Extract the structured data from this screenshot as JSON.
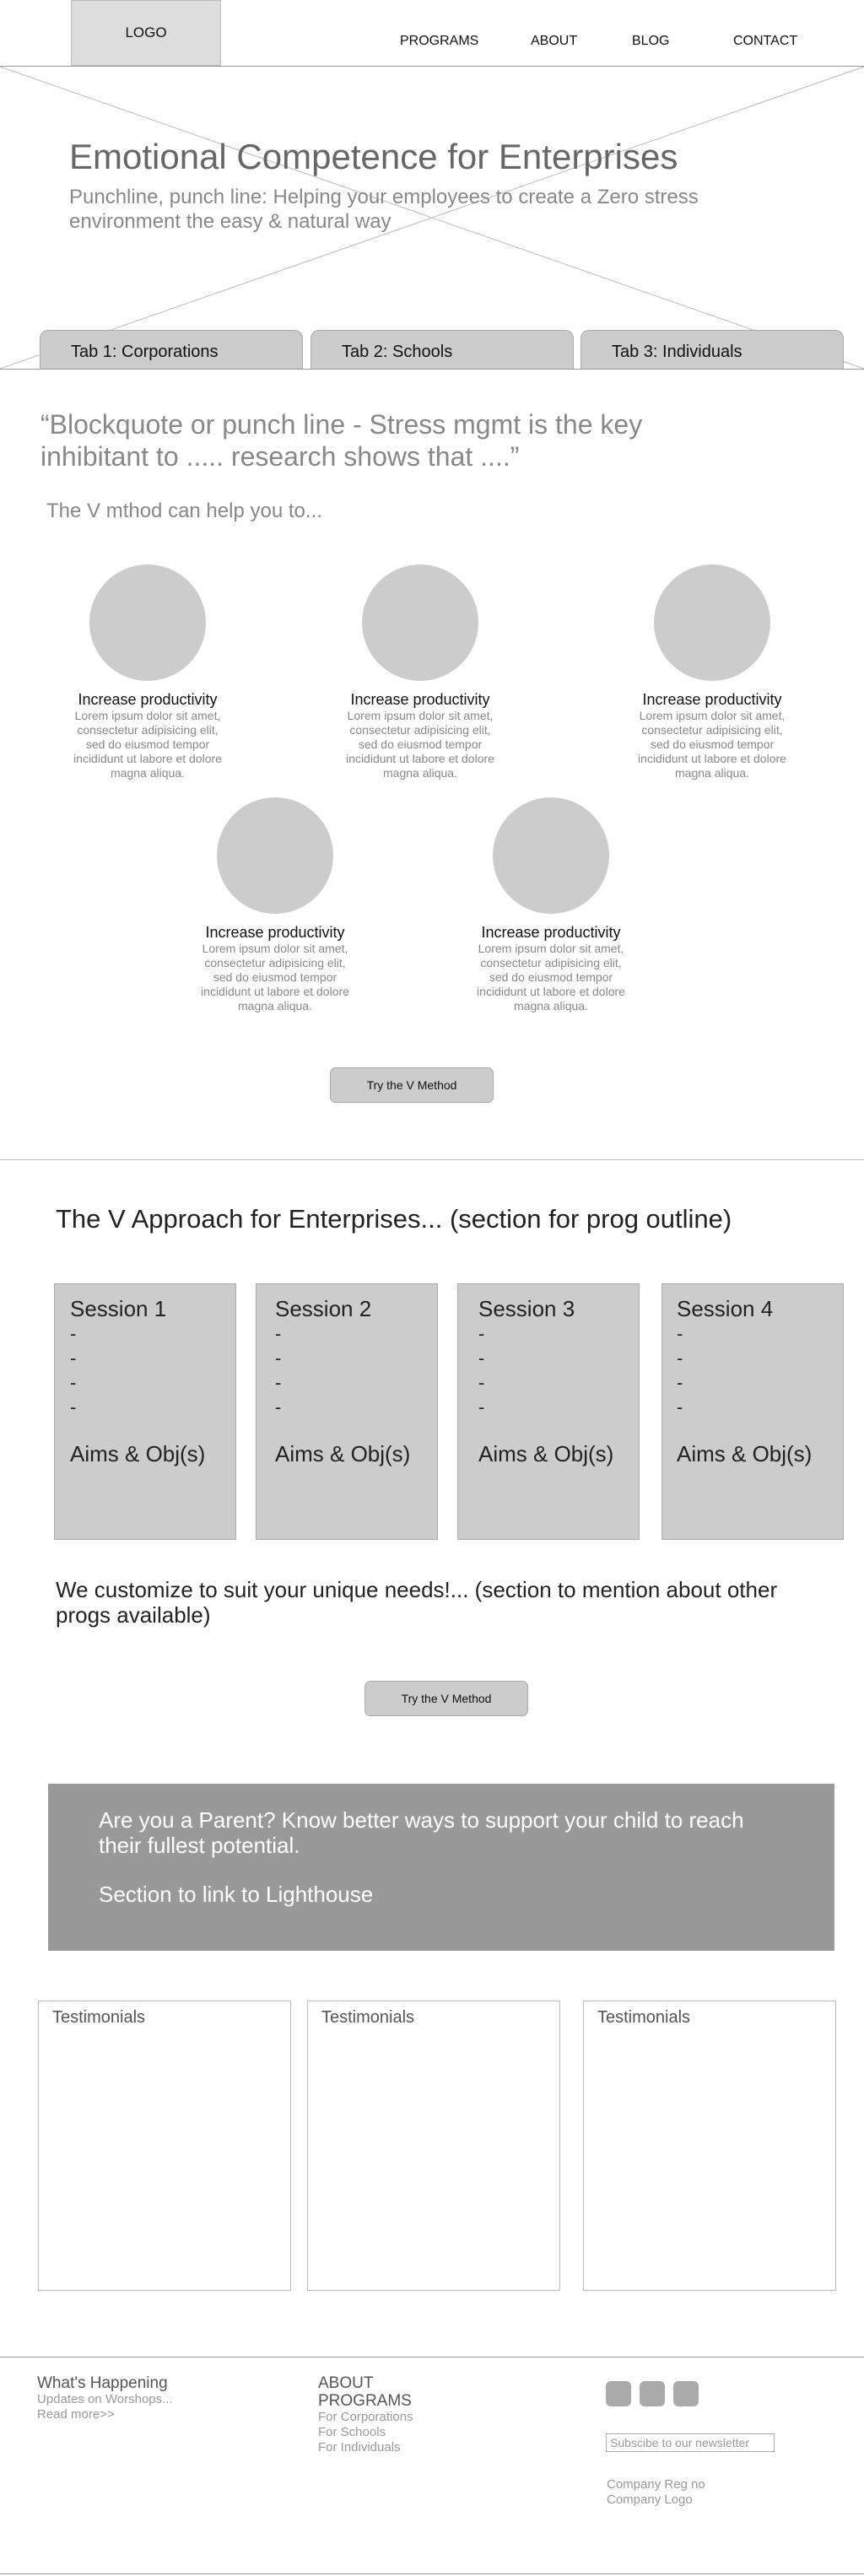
{
  "header": {
    "logo": "LOGO",
    "nav": [
      "PROGRAMS",
      "ABOUT",
      "BLOG",
      "CONTACT"
    ]
  },
  "hero": {
    "title": "Emotional Competence for Enterprises",
    "subtitle": "Punchline, punch line: Helping your employees to create a Zero stress environment the easy & natural way",
    "tabs": [
      "Tab 1: Corporations",
      "Tab 2: Schools",
      "Tab 3: Individuals"
    ]
  },
  "quote": "“Blockquote or punch line - Stress mgmt is the key inhibitant to ..... research shows that ....”",
  "v_method": {
    "lead": "The V mthod can help you to...",
    "benefits": [
      {
        "title": "Increase productivity",
        "text": "Lorem ipsum dolor sit amet, consectetur adipisicing elit, sed do eiusmod tempor incididunt ut labore et dolore magna aliqua."
      },
      {
        "title": "Increase productivity",
        "text": "Lorem ipsum dolor sit amet, consectetur adipisicing elit, sed do eiusmod tempor incididunt ut labore et dolore magna aliqua."
      },
      {
        "title": "Increase productivity",
        "text": "Lorem ipsum dolor sit amet, consectetur adipisicing elit, sed do eiusmod tempor incididunt ut labore et dolore magna aliqua."
      },
      {
        "title": "Increase productivity",
        "text": "Lorem ipsum dolor sit amet, consectetur adipisicing elit, sed do eiusmod tempor incididunt ut labore et dolore magna aliqua."
      },
      {
        "title": "Increase productivity",
        "text": "Lorem ipsum dolor sit amet, consectetur adipisicing elit, sed do eiusmod tempor incididunt ut labore et dolore magna aliqua."
      }
    ],
    "cta": "Try the V Method"
  },
  "approach": {
    "title": "The V Approach for Enterprises... (section for prog outline)",
    "sessions": [
      {
        "title": "Session 1",
        "dashes": [
          "-",
          "-",
          "-",
          "-"
        ],
        "aims": "Aims & Obj(s)"
      },
      {
        "title": "Session 2",
        "dashes": [
          "-",
          "-",
          "-",
          "-"
        ],
        "aims": "Aims & Obj(s)"
      },
      {
        "title": "Session 3",
        "dashes": [
          "-",
          "-",
          "-",
          "-"
        ],
        "aims": "Aims & Obj(s)"
      },
      {
        "title": "Session 4",
        "dashes": [
          "-",
          "-",
          "-",
          "-"
        ],
        "aims": "Aims & Obj(s)"
      }
    ],
    "customize": "We customize to suit your unique needs!... (section to mention about other progs available)",
    "cta": "Try the V Method"
  },
  "parent": {
    "line1": "Are you a Parent? Know better ways to support your child to reach their fullest potential.",
    "line2": "Section to link to Lighthouse"
  },
  "testimonials": [
    "Testimonials",
    "Testimonials",
    "Testimonials"
  ],
  "footer": {
    "whats_happening": {
      "title": "What's Happening",
      "updates": "Updates on Worshops...",
      "read_more": "Read more>>"
    },
    "about": "ABOUT",
    "programs": {
      "title": "PROGRAMS",
      "links": [
        "For Corporations",
        "For Schools",
        "For Individuals"
      ]
    },
    "newsletter_placeholder": "Subscibe to our newsletter",
    "company_reg": "Company Reg no",
    "company_logo": "Company Logo"
  }
}
